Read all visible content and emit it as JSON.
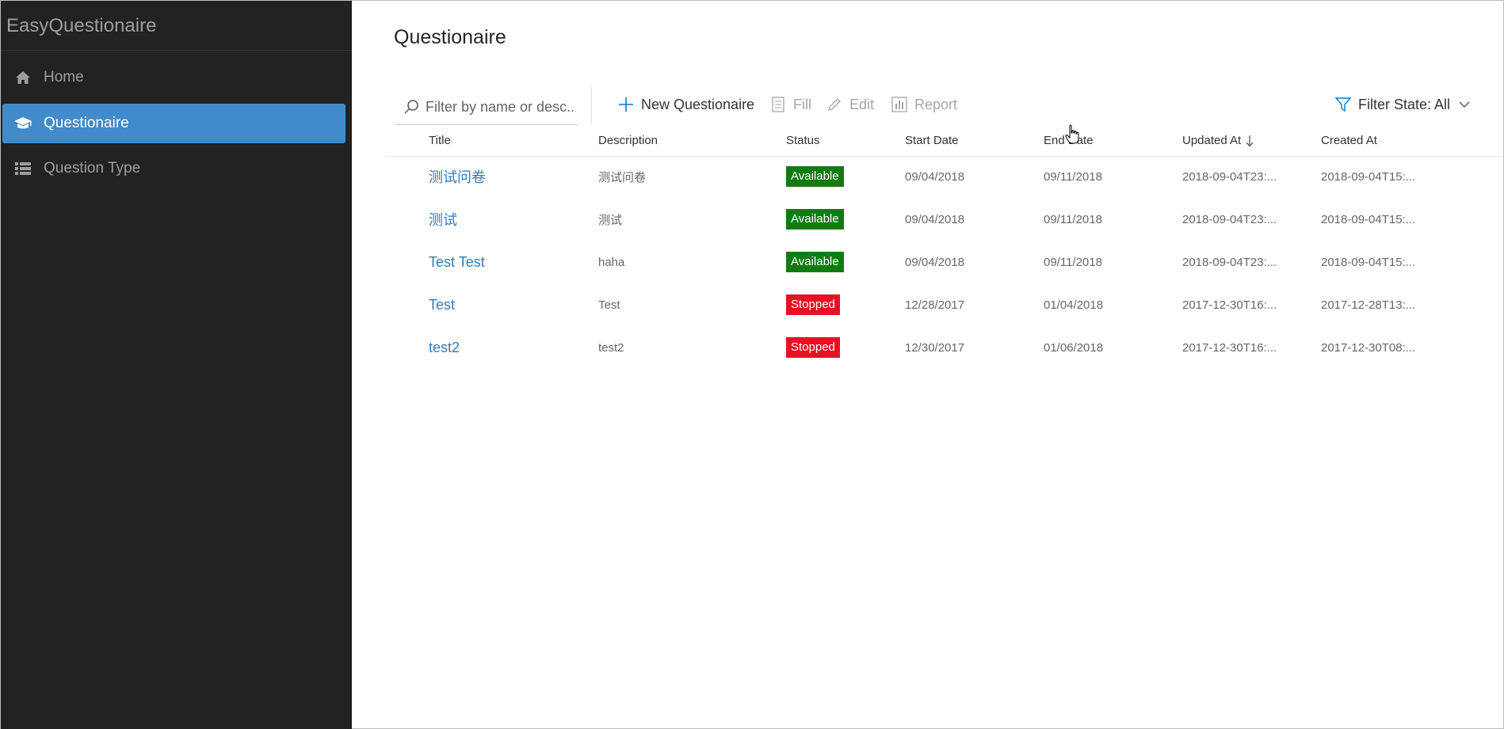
{
  "sidebar": {
    "brand": "EasyQuestionaire",
    "items": [
      {
        "label": "Home",
        "icon": "home-icon",
        "active": false
      },
      {
        "label": "Questionaire",
        "icon": "graduation-cap-icon",
        "active": true
      },
      {
        "label": "Question Type",
        "icon": "list-icon",
        "active": false
      }
    ]
  },
  "page": {
    "title": "Questionaire"
  },
  "commands": {
    "search_placeholder": "Filter by name or desc...",
    "new_label": "New Questionaire",
    "fill_label": "Fill",
    "edit_label": "Edit",
    "report_label": "Report",
    "filter_state_label": "Filter State: All"
  },
  "table": {
    "columns": [
      "Title",
      "Description",
      "Status",
      "Start Date",
      "End Date",
      "Updated At",
      "Created At"
    ],
    "sorted_column": "Updated At",
    "sort_direction": "descending",
    "rows": [
      {
        "title": "测试问卷",
        "description": "测试问卷",
        "status": "Available",
        "start": "09/04/2018",
        "end": "09/11/2018",
        "updated": "2018-09-04T23:...",
        "created": "2018-09-04T15:..."
      },
      {
        "title": "测试",
        "description": "测试",
        "status": "Available",
        "start": "09/04/2018",
        "end": "09/11/2018",
        "updated": "2018-09-04T23:...",
        "created": "2018-09-04T15:..."
      },
      {
        "title": "Test Test",
        "description": "haha",
        "status": "Available",
        "start": "09/04/2018",
        "end": "09/11/2018",
        "updated": "2018-09-04T23:...",
        "created": "2018-09-04T15:..."
      },
      {
        "title": "Test",
        "description": "Test",
        "status": "Stopped",
        "start": "12/28/2017",
        "end": "01/04/2018",
        "updated": "2017-12-30T16:...",
        "created": "2017-12-28T13:..."
      },
      {
        "title": "test2",
        "description": "test2",
        "status": "Stopped",
        "start": "12/30/2017",
        "end": "01/06/2018",
        "updated": "2017-12-30T16:...",
        "created": "2017-12-30T08:..."
      }
    ]
  },
  "colors": {
    "sidebar_bg": "#222222",
    "active_item_bg": "#428bca",
    "available": "#107c10",
    "stopped": "#e81123",
    "link": "#337ab7",
    "accent_icon": "#0078d4"
  }
}
